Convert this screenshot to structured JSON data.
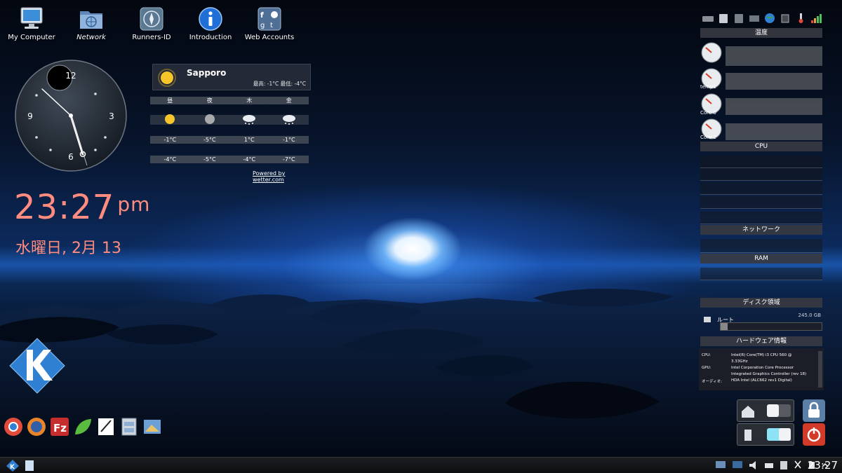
{
  "desktop_icons": [
    {
      "label": "My Computer",
      "icon": "computer-icon"
    },
    {
      "label": "Network",
      "icon": "network-folder-icon"
    },
    {
      "label": "Runners-ID",
      "icon": "compass-icon"
    },
    {
      "label": "Introduction",
      "icon": "info-icon"
    },
    {
      "label": "Web Accounts",
      "icon": "web-accounts-icon"
    }
  ],
  "analog_clock": {
    "numbers": [
      "12",
      "3",
      "6",
      "9"
    ]
  },
  "digital_clock": {
    "time": "23:27",
    "suffix": "pm",
    "date": "水曜日, 2月 13",
    "color": "#ff8c7f"
  },
  "weather": {
    "city": "Sapporo",
    "high_low": "最高: -1°C 最低: -4°C",
    "days": [
      "昼",
      "夜",
      "木",
      "金"
    ],
    "day_icons": [
      "sun-icon",
      "moon-icon",
      "snow-cloud-icon",
      "snow-cloud-icon"
    ],
    "highs": [
      "-1°C",
      "-5°C",
      "1°C",
      "-1°C"
    ],
    "lows": [
      "-4°C",
      "-5°C",
      "-4°C",
      "-7°C"
    ],
    "powered": "Powered by wetter.com"
  },
  "system_monitor": {
    "temp_header": "温度",
    "sensors": [
      "",
      "temp1",
      "Core 0",
      "Core 2"
    ],
    "cpu_header": "CPU",
    "network_header": "ネットワーク",
    "ram_header": "RAM",
    "disk_header": "ディスク領域",
    "disk": {
      "label": "ルート",
      "size": "245.0 GB"
    },
    "hw_header": "ハードウェア情報",
    "hw_rows": [
      {
        "k": "CPU:",
        "v": "Intel(R) Core(TM) i3 CPU 560 @"
      },
      {
        "k": "",
        "v": "3.33GHz"
      },
      {
        "k": "GPU:",
        "v": "Intel Corporation Core Processor"
      },
      {
        "k": "",
        "v": "Integrated Graphics Controller (rev 18)"
      },
      {
        "k": "オーディオ:",
        "v": "HDA Intel (ALC662 rev1 Digital)"
      }
    ]
  },
  "taskbar": {
    "time": "23:27"
  }
}
